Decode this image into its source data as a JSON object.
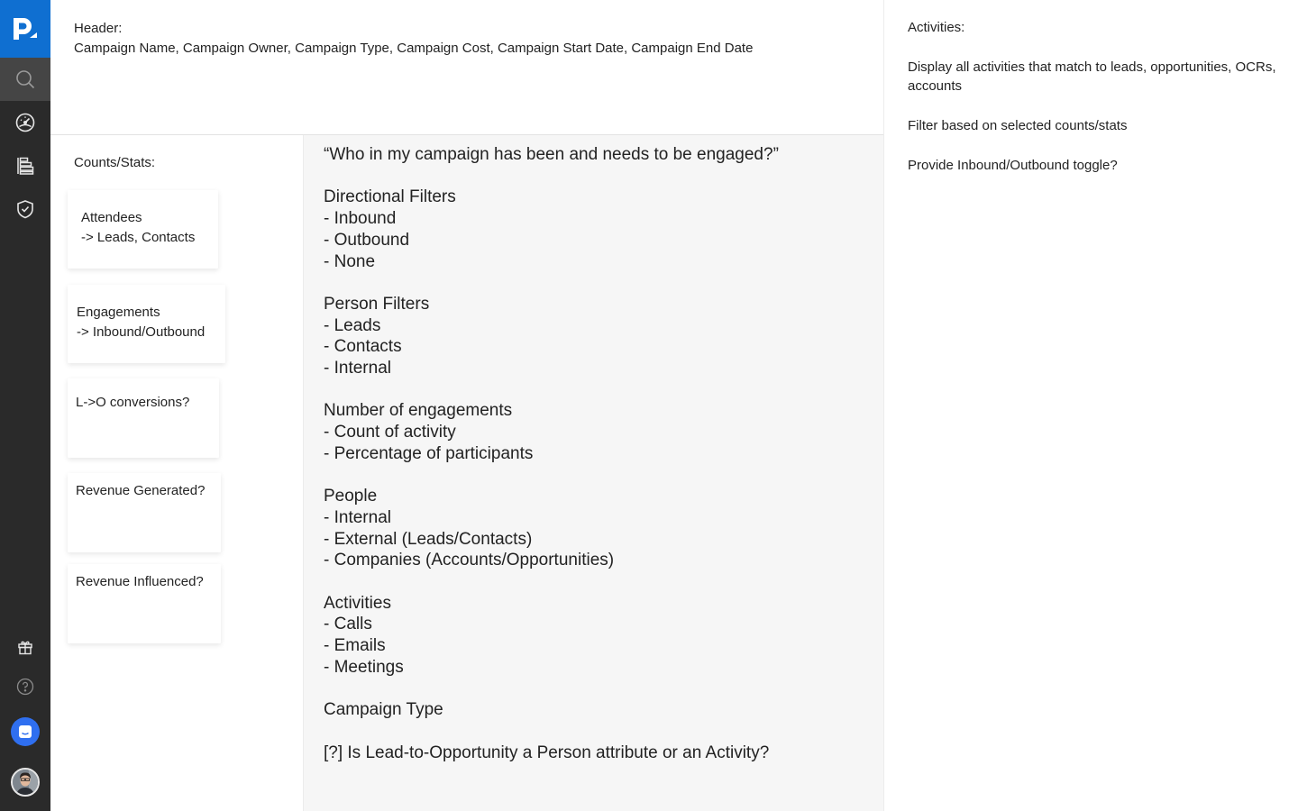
{
  "sidebar": {
    "logo_icon": "pipeliner-p-logo",
    "nav": [
      {
        "icon": "search-icon",
        "active": true
      },
      {
        "icon": "dashboard-gauge-icon",
        "active": false
      },
      {
        "icon": "list-stack-icon",
        "active": false
      },
      {
        "icon": "shield-check-icon",
        "active": false
      }
    ],
    "bottom": [
      {
        "icon": "gift-icon"
      },
      {
        "icon": "help-circle-icon"
      },
      {
        "icon": "chat-icon"
      },
      {
        "icon": "user-avatar"
      }
    ],
    "colors": {
      "logo_bg": "#0f6fd1",
      "sidebar_bg": "#2a2a2a",
      "active_bg": "#454545",
      "chat_bg": "#2f6ff0"
    }
  },
  "header": {
    "label": "Header:",
    "fields": "Campaign Name, Campaign Owner, Campaign Type, Campaign Cost, Campaign Start Date, Campaign End Date"
  },
  "counts": {
    "title": "Counts/Stats:",
    "cards": [
      {
        "lines": [
          "Attendees",
          "-> Leads, Contacts"
        ]
      },
      {
        "lines": [
          "Engagements",
          "-> Inbound/Outbound"
        ]
      },
      {
        "lines": [
          "L->O conversions?"
        ]
      },
      {
        "lines": [
          "Revenue Generated?"
        ]
      },
      {
        "lines": [
          "Revenue Influenced?"
        ]
      }
    ]
  },
  "notes": {
    "lines": [
      "“Who in my campaign has been and needs to be engaged?”",
      "",
      "Directional Filters",
      "- Inbound",
      "- Outbound",
      "- None",
      "",
      "Person Filters",
      "- Leads",
      "- Contacts",
      "- Internal",
      "",
      "Number of engagements",
      "- Count of activity",
      "- Percentage of participants",
      "",
      "People",
      "- Internal",
      "- External (Leads/Contacts)",
      "- Companies (Accounts/Opportunities)",
      "",
      "Activities",
      "- Calls",
      "- Emails",
      "- Meetings",
      "",
      "Campaign Type",
      "",
      "[?] Is Lead-to-Opportunity a Person attribute or an Activity?"
    ]
  },
  "activities": {
    "title": "Activities:",
    "items": [
      "Display all activities that match to leads, opportunities, OCRs, accounts",
      "Filter based on selected counts/stats",
      "Provide Inbound/Outbound toggle?"
    ]
  }
}
